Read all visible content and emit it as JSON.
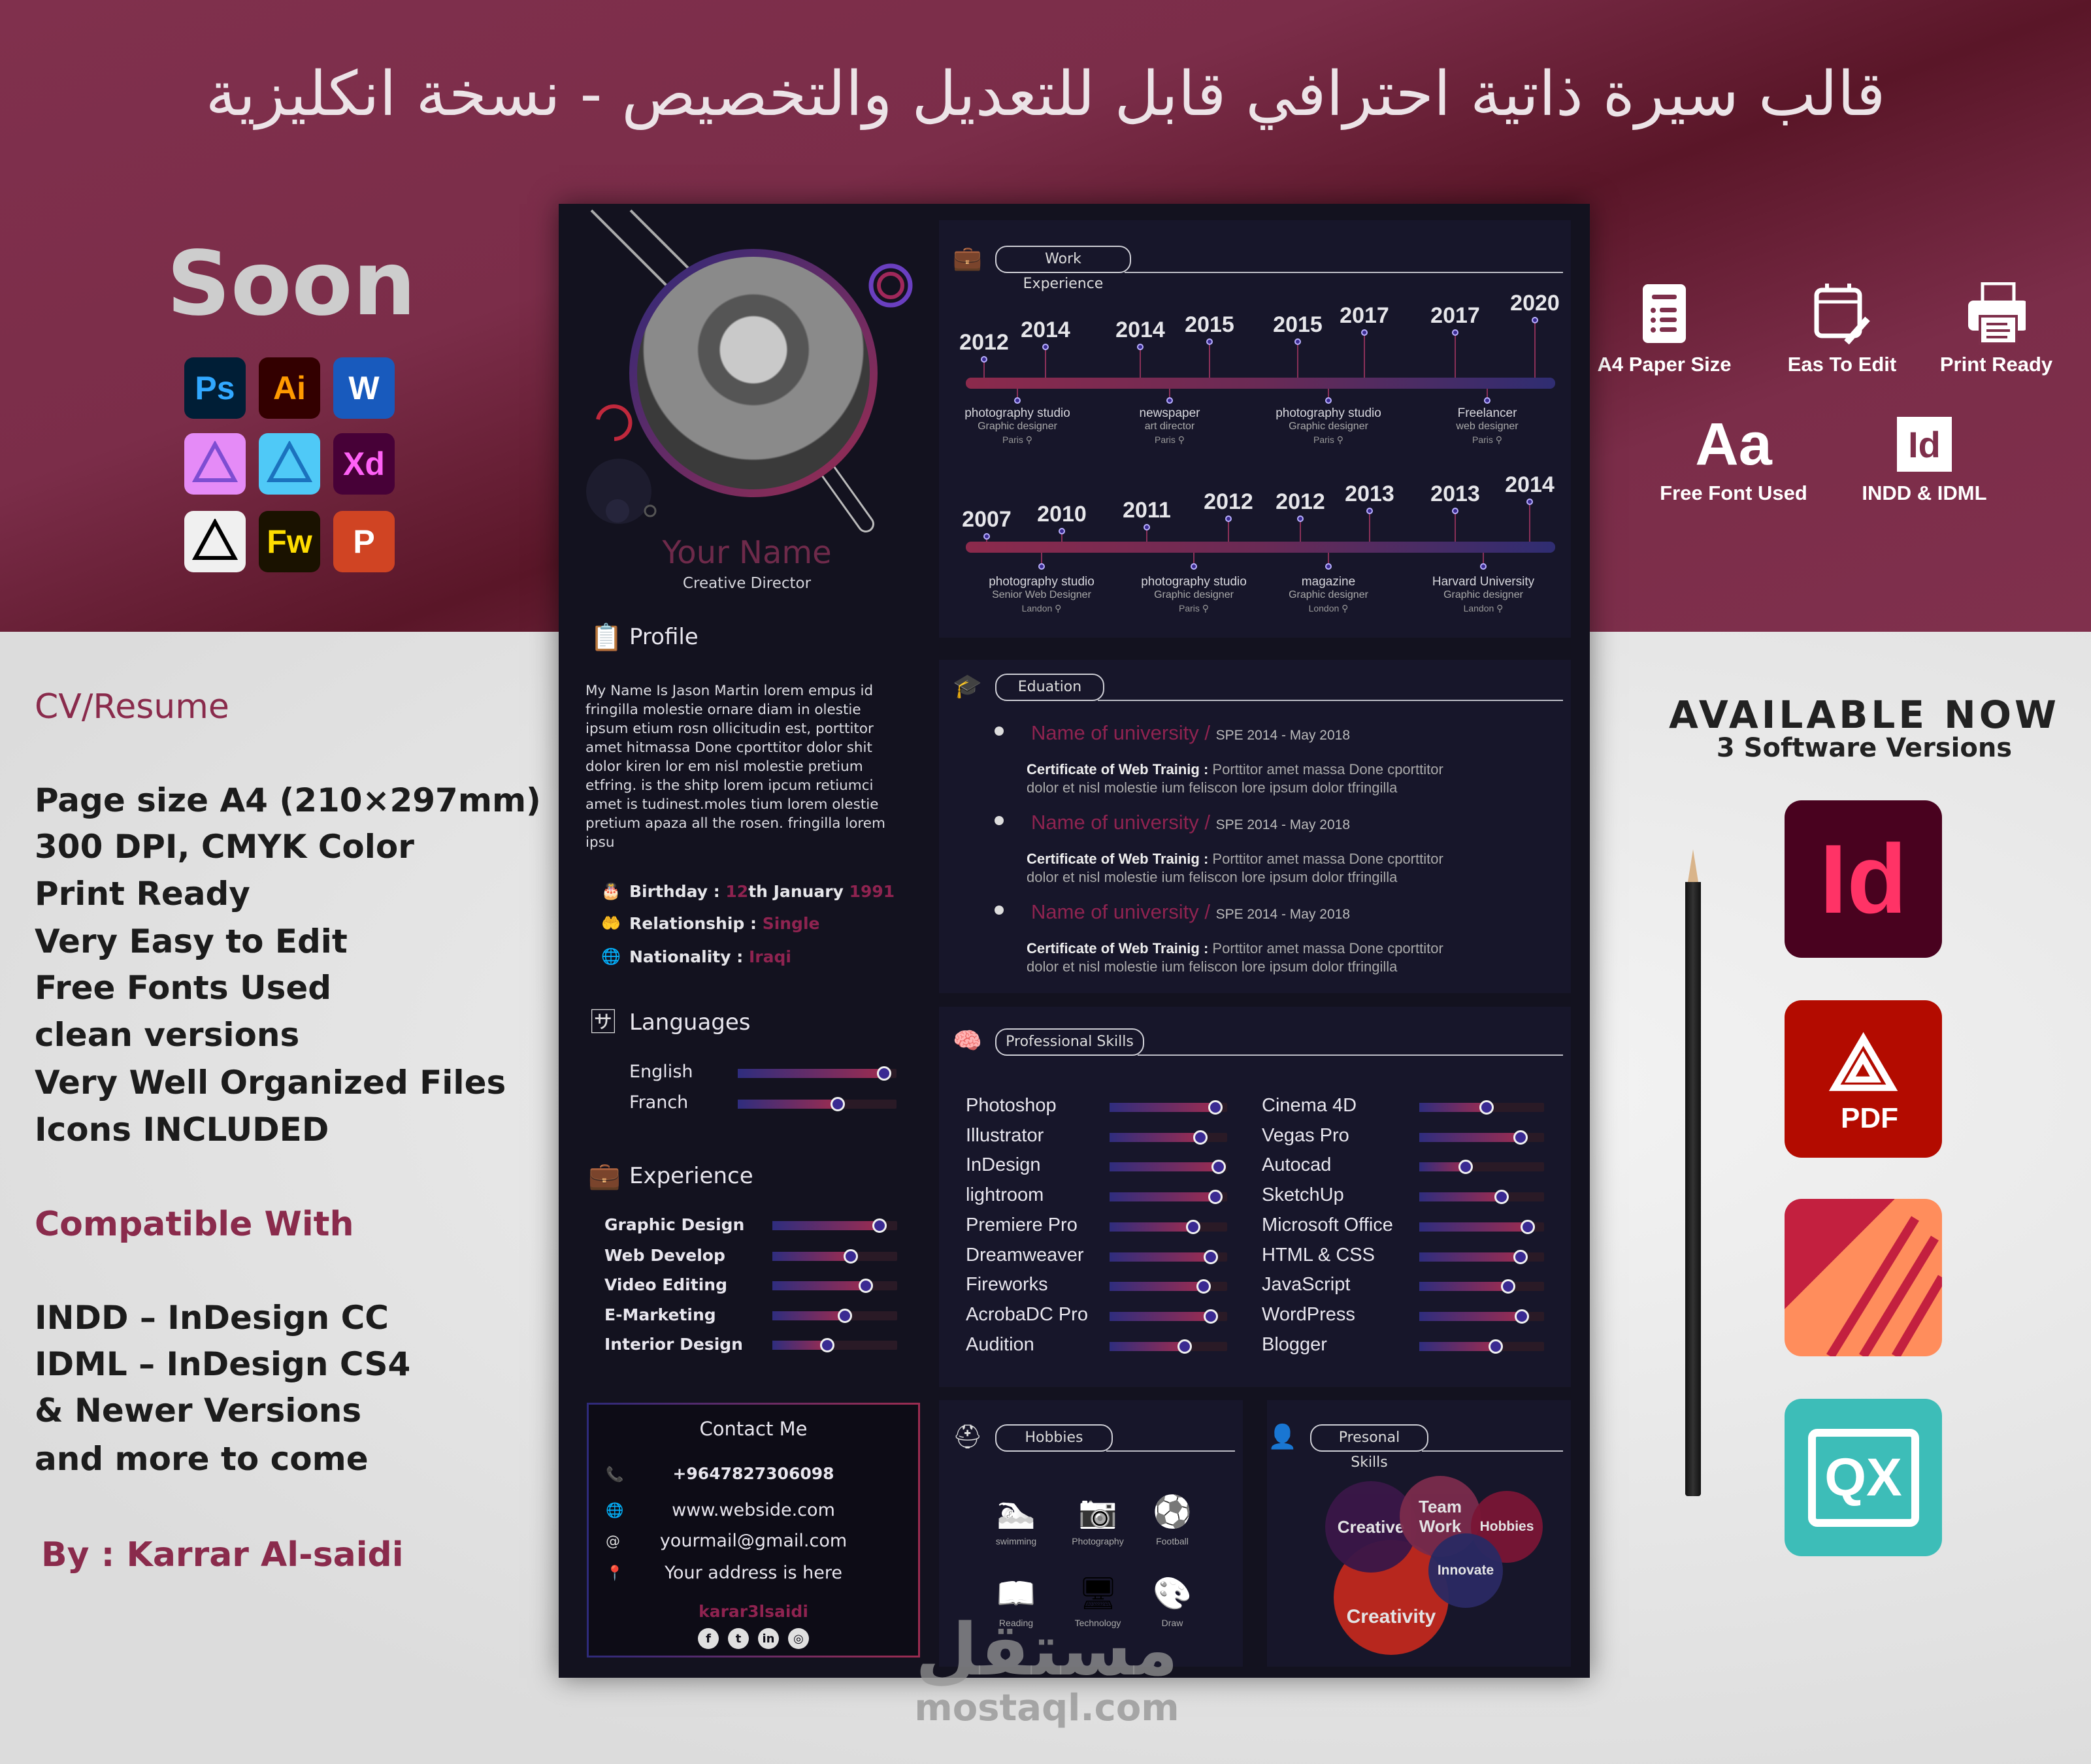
{
  "banner": {
    "title": "قالب سيرة ذاتية احترافي قابل للتعديل والتخصيص - نسخة انكليزية",
    "soon": "Soon",
    "apps": [
      {
        "icon": "photoshop-icon",
        "label": "Ps",
        "bg": "#001e36",
        "fg": "#31a8ff"
      },
      {
        "icon": "illustrator-icon",
        "label": "Ai",
        "bg": "#330000",
        "fg": "#ff9a00"
      },
      {
        "icon": "word-icon",
        "label": "W",
        "bg": "#185abd",
        "fg": "#ffffff"
      },
      {
        "icon": "affinity-photo-icon",
        "label": "",
        "bg": "#e58bf7",
        "fg": "#7e4dd2"
      },
      {
        "icon": "affinity-designer-icon",
        "label": "",
        "bg": "#4fc9f7",
        "fg": "#1b72be"
      },
      {
        "icon": "xd-icon",
        "label": "Xd",
        "bg": "#470137",
        "fg": "#ff61f6"
      },
      {
        "icon": "inkscape-icon",
        "label": "",
        "bg": "#f0f0f0",
        "fg": "#000000"
      },
      {
        "icon": "fireworks-icon",
        "label": "Fw",
        "bg": "#1a1200",
        "fg": "#ffdd00"
      },
      {
        "icon": "powerpoint-icon",
        "label": "P",
        "bg": "#d04423",
        "fg": "#ffffff"
      }
    ],
    "features": [
      {
        "icon": "document-list-icon",
        "label": "A4 Paper Size"
      },
      {
        "icon": "edit-calendar-icon",
        "label": "Eas To Edit"
      },
      {
        "icon": "printer-icon",
        "label": "Print Ready"
      },
      {
        "icon": "font-icon",
        "label": "Free Font Used",
        "glyph": "Aa"
      },
      {
        "icon": "indesign-icon",
        "label": "INDD & IDML",
        "glyph": "Id"
      }
    ]
  },
  "left": {
    "cv_label": "CV/Resume",
    "specs": [
      "Page size A4 (210×297mm)",
      "300 DPI, CMYK Color",
      "Print Ready",
      "Very Easy to Edit",
      "Free Fonts Used",
      "clean versions",
      "Very Well Organized Files",
      "Icons INCLUDED"
    ],
    "compat_label": "Compatible With",
    "compat": [
      "INDD – InDesign CC",
      "IDML – InDesign CS4",
      "& Newer Versions",
      "and more to come"
    ],
    "author": "By : Karrar Al-saidi"
  },
  "right": {
    "available": "AVAILABLE NOW",
    "versions": "3 Software Versions",
    "apps": [
      {
        "icon": "indesign-icon",
        "label": "Id",
        "bg": "#49021f",
        "fg": "#ff3366"
      },
      {
        "icon": "pdf-icon",
        "label": "PDF",
        "bg": "#b30b00",
        "fg": "#ffffff"
      },
      {
        "icon": "affinity-publisher-icon",
        "label": "",
        "bg": "#ff8d5c",
        "fg": "#c3203f"
      },
      {
        "icon": "quarkxpress-icon",
        "label": "QX",
        "bg": "#3dbdb8",
        "fg": "#ffffff"
      }
    ]
  },
  "cv": {
    "name": "Your Name",
    "role": "Creative Director",
    "profile": {
      "heading": "Profile",
      "text": "My Name Is Jason Martin lorem empus id fringilla molestie ornare diam in olestie ipsum etium rosn ollicitudin est, porttitor amet hitmassa Done cporttitor dolor shit dolor kiren lor   em nisl molestie pretium etfring. is the shitp lorem ipcum retiumci amet is tudinest.moles tium lorem olestie pretium apaza all the rosen.  fringilla lorem ipsu"
    },
    "info": [
      {
        "icon": "cake-icon",
        "label": "Birthday :",
        "parts": [
          {
            "t": "12",
            "c": "pink"
          },
          {
            "t": "th January ",
            "c": "w"
          },
          {
            "t": "1991",
            "c": "pink"
          }
        ]
      },
      {
        "icon": "heart-hand-icon",
        "label": "Relationship :",
        "parts": [
          {
            "t": "Single",
            "c": "pink"
          }
        ]
      },
      {
        "icon": "globe-icon",
        "label": "Nationality :",
        "parts": [
          {
            "t": "Iraqi",
            "c": "pink"
          }
        ]
      }
    ],
    "languages": {
      "heading": "Languages",
      "items": [
        {
          "name": "English",
          "level": 0.92
        },
        {
          "name": "Franch",
          "level": 0.63
        }
      ]
    },
    "experience": {
      "heading": "Experience",
      "items": [
        {
          "name": "Graphic Design",
          "level": 0.86
        },
        {
          "name": "Web Develop",
          "level": 0.63
        },
        {
          "name": "Video Editing",
          "level": 0.75
        },
        {
          "name": "E-Marketing",
          "level": 0.58
        },
        {
          "name": "Interior Design",
          "level": 0.44
        }
      ]
    },
    "contact": {
      "heading": "Contact Me",
      "rows": [
        {
          "icon": "phone-icon",
          "text": "+9647827306098"
        },
        {
          "icon": "globe-icon",
          "text": "www.webside.com"
        },
        {
          "icon": "at-icon",
          "text": "yourmail@gmail.com"
        },
        {
          "icon": "map-pin-icon",
          "text": "Your address is here"
        }
      ],
      "handle": "karar3lsaidi",
      "socials": [
        "facebook-icon",
        "twitter-icon",
        "linkedin-icon",
        "instagram-icon"
      ]
    },
    "work": {
      "heading": "Work Experience",
      "row1": {
        "years": [
          "2012",
          "2014",
          "2014",
          "2015",
          "2015",
          "2017",
          "2017",
          "2020"
        ],
        "jobs": [
          {
            "place": "photography studio",
            "role": "Graphic designer",
            "city": "Paris"
          },
          {
            "place": "newspaper",
            "role": "art director",
            "city": "Paris"
          },
          {
            "place": "photography studio",
            "role": "Graphic designer",
            "city": "Paris"
          },
          {
            "place": "Freelancer",
            "role": "web designer",
            "city": "Paris"
          }
        ]
      },
      "row2": {
        "years": [
          "2007",
          "2010",
          "2011",
          "2012",
          "2012",
          "2013",
          "2013",
          "2014"
        ],
        "jobs": [
          {
            "place": "photography studio",
            "role": "Senior Web Designer",
            "city": "Landon"
          },
          {
            "place": "photography studio",
            "role": "Graphic designer",
            "city": "Paris"
          },
          {
            "place": "magazine",
            "role": "Graphic designer",
            "city": "London"
          },
          {
            "place": "Harvard University",
            "role": "Graphic designer",
            "city": "Landon"
          }
        ]
      }
    },
    "education": {
      "heading": "Eduation",
      "items": [
        {
          "school": "Name of university",
          "sep": " / ",
          "date": "SPE 2014 - May 2018",
          "cert": "Certificate of Web Trainig :",
          "desc1": " Porttitor amet massa Done cporttitor",
          "desc2": "dolor et nisl molestie ium feliscon lore  ipsum dolor tfringilla"
        },
        {
          "school": "Name of university",
          "sep": " / ",
          "date": "SPE 2014 - May 2018",
          "cert": "Certificate of Web Trainig :",
          "desc1": " Porttitor amet massa Done cporttitor",
          "desc2": "dolor et nisl molestie ium feliscon lore  ipsum dolor tfringilla"
        },
        {
          "school": "Name of university",
          "sep": " / ",
          "date": "SPE 2014 - May 2018",
          "cert": "Certificate of Web Trainig :",
          "desc1": " Porttitor amet massa Done cporttitor",
          "desc2": "dolor et nisl molestie ium feliscon lore  ipsum dolor tfringilla"
        }
      ]
    },
    "skills": {
      "heading": "Professional Skills",
      "left": [
        {
          "name": "Photoshop",
          "level": 0.9
        },
        {
          "name": "Illustrator",
          "level": 0.77
        },
        {
          "name": "InDesign",
          "level": 0.93
        },
        {
          "name": "lightroom",
          "level": 0.9
        },
        {
          "name": "Premiere Pro",
          "level": 0.71
        },
        {
          "name": "Dreamweaver",
          "level": 0.86
        },
        {
          "name": "Fireworks",
          "level": 0.8
        },
        {
          "name": "AcrobaDC Pro",
          "level": 0.86
        },
        {
          "name": "Audition",
          "level": 0.64
        }
      ],
      "right": [
        {
          "name": "Cinema 4D",
          "level": 0.54
        },
        {
          "name": "Vegas Pro",
          "level": 0.81
        },
        {
          "name": "Autocad",
          "level": 0.37
        },
        {
          "name": "SketchUp",
          "level": 0.66
        },
        {
          "name": "Microsoft Office",
          "level": 0.87
        },
        {
          "name": "HTML & CSS",
          "level": 0.81
        },
        {
          "name": "JavaScript",
          "level": 0.71
        },
        {
          "name": "WordPress",
          "level": 0.82
        },
        {
          "name": "Blogger",
          "level": 0.61
        }
      ]
    },
    "hobbies": {
      "heading": "Hobbies",
      "items": [
        {
          "icon": "swimming-icon",
          "label": "swimming",
          "glyph": "🏊"
        },
        {
          "icon": "camera-icon",
          "label": "Photography",
          "glyph": "📷"
        },
        {
          "icon": "football-icon",
          "label": "Football",
          "glyph": "⚽"
        },
        {
          "icon": "reading-icon",
          "label": "Reading",
          "glyph": "📖"
        },
        {
          "icon": "computer-icon",
          "label": "Technology",
          "glyph": "🖥"
        },
        {
          "icon": "palette-icon",
          "label": "Draw",
          "glyph": "🎨"
        }
      ]
    },
    "personal": {
      "heading": "Presonal Skills",
      "items": [
        {
          "label": "Creativity",
          "color": "#c0281e"
        },
        {
          "label": "Creative",
          "color": "#3a1748"
        },
        {
          "label": "Team Work",
          "color": "#7a2b4c"
        },
        {
          "label": "Hobbies",
          "color": "#7a1535"
        },
        {
          "label": "Innovate",
          "color": "#2a2a63"
        }
      ]
    }
  },
  "watermark": {
    "arabic": "مستقل",
    "latin": "mostaql.com"
  },
  "colors": {
    "accent": "#8f2350",
    "band": "#7e2f4b",
    "sheet": "#13121f",
    "knob": "#3a2a92"
  }
}
